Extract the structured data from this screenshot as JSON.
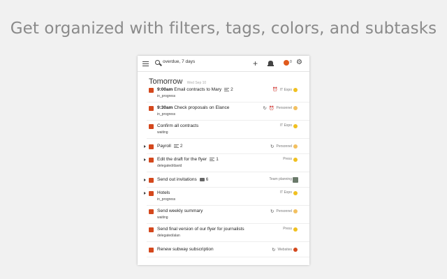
{
  "headline": "Get organized with filters, tags, colors, and subtasks",
  "search": {
    "value": "overdue, 7 days"
  },
  "topbar": {
    "avatar_count": "0"
  },
  "day": {
    "title": "Tomorrow",
    "date": "Wed Sep 10"
  },
  "colors": {
    "checkbox": "#d4481d",
    "yellow": "#f0c020",
    "orange_dot": "#f0b030",
    "peach_dot": "#f2c060",
    "red_dot": "#d4481d"
  },
  "tasks": [
    {
      "time": "9:00am",
      "title": "Email contracts to Mary",
      "sub": "in_progress",
      "note_count": "2",
      "alarm": true,
      "project": "IT Expo",
      "dot": "#f0c020"
    },
    {
      "time": "9:30am",
      "title": "Check proposals on Elance",
      "sub": "in_progress",
      "repeat": true,
      "alarm": true,
      "project": "Personnel",
      "dot": "#f2c060"
    },
    {
      "title": "Confirm all contracts",
      "sub": "waiting",
      "project": "IT Expo",
      "dot": "#f0c020"
    },
    {
      "title": "Payroll",
      "note_count": "2",
      "has_children": true,
      "repeat": true,
      "project": "Personnel",
      "dot": "#f2c060"
    },
    {
      "title": "Edit the draft for the flyer",
      "sub": "delegated/david",
      "note_count": "1",
      "has_children": true,
      "project": "Press",
      "dot": "#f0c020"
    },
    {
      "title": "Send out invitations",
      "comment_count": "6",
      "has_children": true,
      "project": "Team planning",
      "avatar": true
    },
    {
      "title": "Hotels",
      "sub": "in_progress",
      "has_children": true,
      "project": "IT Expo",
      "dot": "#f0c020"
    },
    {
      "title": "Send weekly summary",
      "sub": "waiting",
      "repeat": true,
      "project": "Personnel",
      "dot": "#f2c060"
    },
    {
      "title": "Send final version of our flyer for journalists",
      "sub": "delegated/alan",
      "project": "Press",
      "dot": "#f0c020"
    },
    {
      "title": "Renew subway subscription",
      "repeat": true,
      "project": "Websites",
      "dot": "#d4481d"
    }
  ]
}
